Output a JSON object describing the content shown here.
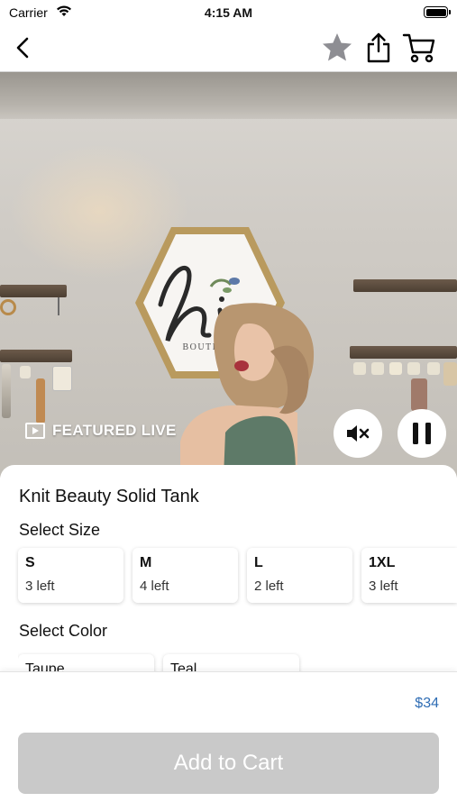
{
  "status_bar": {
    "carrier": "Carrier",
    "time": "4:15 AM"
  },
  "nav": {
    "icons": [
      "chevron-left-icon",
      "star-icon",
      "share-icon",
      "cart-icon"
    ],
    "star_color": "#8e8e93"
  },
  "video": {
    "featured_label": "FEATURED LIVE",
    "sign_text": "BOUTIQUE",
    "controls": [
      "mute-icon",
      "pause-icon"
    ]
  },
  "product": {
    "title": "Knit Beauty Solid Tank",
    "size_label": "Select Size",
    "sizes": [
      {
        "name": "S",
        "left": "3 left"
      },
      {
        "name": "M",
        "left": "4 left"
      },
      {
        "name": "L",
        "left": "2 left"
      },
      {
        "name": "1XL",
        "left": "3 left"
      }
    ],
    "color_label": "Select Color",
    "colors": [
      {
        "name": "Taupe"
      },
      {
        "name": "Teal"
      }
    ]
  },
  "footer": {
    "price": "$34",
    "add_to_cart": "Add to Cart",
    "price_color": "#2f6db4",
    "button_color": "#c9c9c9"
  }
}
